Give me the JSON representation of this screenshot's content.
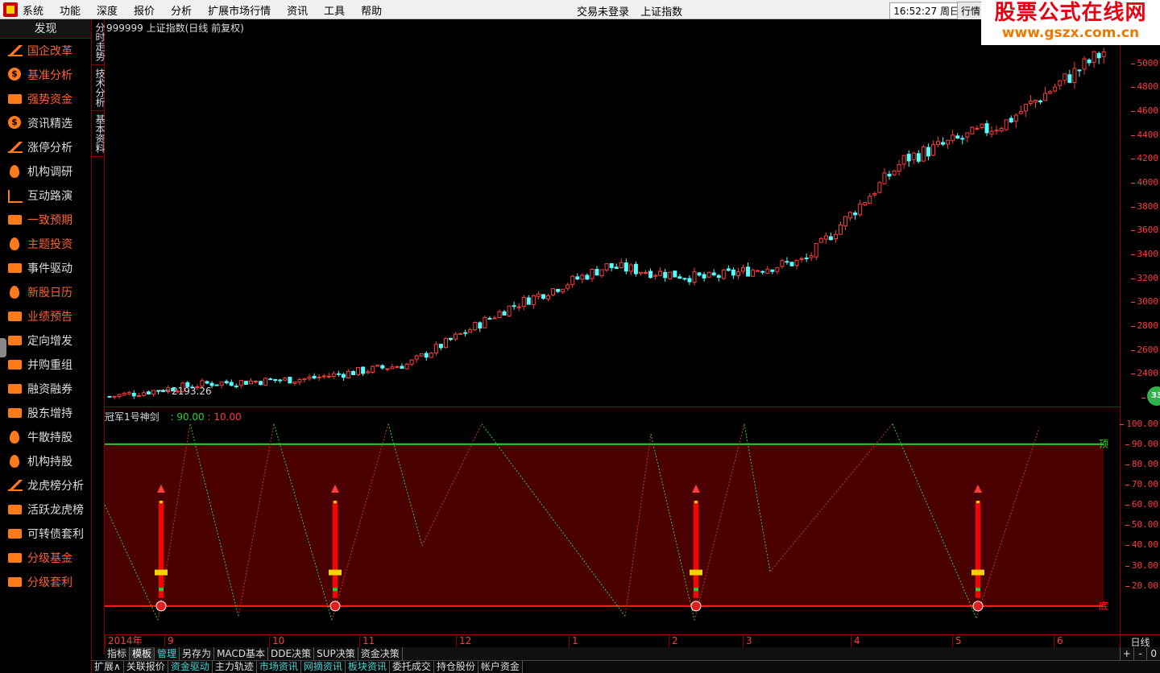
{
  "menu": [
    "系统",
    "功能",
    "深度",
    "报价",
    "分析",
    "扩展市场行情",
    "资讯",
    "工具",
    "帮助"
  ],
  "status": {
    "login": "交易未登录",
    "index_name": "上证指数"
  },
  "clock": "16:52:27 周日",
  "hangqing_button": "行情",
  "brand": {
    "title": "股票公式在线网",
    "url": "www.gszx.com.cn"
  },
  "sidebar": {
    "header": "发现",
    "items": [
      {
        "label": "国企改革",
        "icon": "chart-up-icon",
        "hl": true
      },
      {
        "label": "基准分析",
        "icon": "coins-icon",
        "hl": true
      },
      {
        "label": "强势资金",
        "icon": "briefcase-icon",
        "hl": true
      },
      {
        "label": "资讯精选",
        "icon": "dollar-coin-icon",
        "hl": false
      },
      {
        "label": "涨停分析",
        "icon": "chart-up-icon",
        "hl": false
      },
      {
        "label": "机构调研",
        "icon": "target-icon",
        "hl": false
      },
      {
        "label": "互动路演",
        "icon": "line-chart-icon",
        "hl": false
      },
      {
        "label": "一致预期",
        "icon": "handshake-icon",
        "hl": true
      },
      {
        "label": "主题投资",
        "icon": "umbrella-icon",
        "hl": true
      },
      {
        "label": "事件驱动",
        "icon": "money-bag-icon",
        "hl": false
      },
      {
        "label": "新股日历",
        "icon": "medal-icon",
        "hl": true
      },
      {
        "label": "业绩预告",
        "icon": "wallet-icon",
        "hl": true
      },
      {
        "label": "定向增发",
        "icon": "printer-icon",
        "hl": false
      },
      {
        "label": "并购重组",
        "icon": "piggy-bank-icon",
        "hl": false
      },
      {
        "label": "融资融券",
        "icon": "hand-money-icon",
        "hl": false
      },
      {
        "label": "股东增持",
        "icon": "dollar-doc-icon",
        "hl": false
      },
      {
        "label": "牛散持股",
        "icon": "person-pin-icon",
        "hl": false
      },
      {
        "label": "机构持股",
        "icon": "umbrella-icon",
        "hl": false
      },
      {
        "label": "龙虎榜分析",
        "icon": "bar-chart-icon",
        "hl": false
      },
      {
        "label": "活跃龙虎榜",
        "icon": "user-icon",
        "hl": false
      },
      {
        "label": "可转债套利",
        "icon": "wallet-icon",
        "hl": false
      },
      {
        "label": "分级基金",
        "icon": "piggy-bank-icon",
        "hl": true
      },
      {
        "label": "分级套利",
        "icon": "wallet-icon",
        "hl": true
      }
    ]
  },
  "vtabs": [
    "分时走势",
    "技术分析",
    "基本资料"
  ],
  "main": {
    "title": "999999 上证指数(日线 前复权)",
    "low_label": "2193.26"
  },
  "main_yaxis": [
    "5000",
    "4800",
    "4600",
    "4400",
    "4200",
    "4000",
    "3800",
    "3600",
    "3400",
    "3200",
    "3000",
    "2800",
    "2600",
    "2400",
    "22"
  ],
  "indicator": {
    "name": "冠军1号神剑",
    "top_value": ": 90.00",
    "bottom_value": ": 10.00",
    "top_label": "顶",
    "bottom_label": "底",
    "yaxis": [
      "100.00",
      "90.00",
      "80.00",
      "70.00",
      "60.00",
      "50.00",
      "40.00",
      "30.00",
      "20.00"
    ]
  },
  "xaxis": [
    "2014年",
    "9",
    "10",
    "11",
    "12",
    "1",
    "2",
    "3",
    "4",
    "5",
    "6"
  ],
  "period": "日线",
  "indicator_tabs": [
    {
      "label": "指标",
      "active": false,
      "cyan": false
    },
    {
      "label": "模板",
      "active": true,
      "cyan": false
    },
    {
      "label": "管理",
      "active": false,
      "cyan": true
    },
    {
      "label": "另存为",
      "active": false,
      "cyan": false
    },
    {
      "label": "MACD基本",
      "active": false,
      "cyan": false
    },
    {
      "label": "DDE决策",
      "active": false,
      "cyan": false
    },
    {
      "label": "SUP决策",
      "active": false,
      "cyan": false
    },
    {
      "label": "资金决策",
      "active": false,
      "cyan": false
    }
  ],
  "zoom": [
    "+",
    "-",
    "0"
  ],
  "bottom_tabs": [
    {
      "label": "扩展∧",
      "cyan": false
    },
    {
      "label": "关联报价",
      "cyan": false
    },
    {
      "label": "资金驱动",
      "cyan": true
    },
    {
      "label": "主力轨迹",
      "cyan": false
    },
    {
      "label": "市场资讯",
      "cyan": true
    },
    {
      "label": "网摘资讯",
      "cyan": true
    },
    {
      "label": "板块资讯",
      "cyan": true
    },
    {
      "label": "委托成交",
      "cyan": false
    },
    {
      "label": "持仓股份",
      "cyan": false
    },
    {
      "label": "帐户资金",
      "cyan": false
    }
  ],
  "badge": "33",
  "colors": {
    "up": "#ff3b3b",
    "down": "#54ffff",
    "bg": "#000000",
    "indicator_fill": "#4a0000",
    "top_line": "#2bd22b",
    "bottom_line": "#ff2020"
  },
  "chart_data": [
    {
      "type": "candlestick",
      "title": "999999 上证指数(日线 前复权)",
      "approx_close_path": [
        {
          "x": "2014-08",
          "y": 2210
        },
        {
          "x": "2014-09",
          "y": 2320
        },
        {
          "x": "2014-10",
          "y": 2360
        },
        {
          "x": "2014-11",
          "y": 2480
        },
        {
          "x": "2014-12",
          "y": 2950
        },
        {
          "x": "2015-01",
          "y": 3300
        },
        {
          "x": "2015-02",
          "y": 3200
        },
        {
          "x": "2015-03",
          "y": 3350
        },
        {
          "x": "2015-04",
          "y": 4200
        },
        {
          "x": "2015-05",
          "y": 4500
        },
        {
          "x": "2015-06",
          "y": 5100
        }
      ],
      "annotated_low": 2193.26,
      "ylim": [
        2200,
        5100
      ]
    },
    {
      "type": "line",
      "title": "冠军1号神剑",
      "zigzag": [
        60,
        3,
        100,
        5,
        100,
        3,
        100,
        40,
        100,
        5,
        95,
        3,
        100,
        27,
        100,
        4,
        98
      ],
      "hlines": {
        "top": 90,
        "bottom": 10
      },
      "buy_signals": 4,
      "ylim": [
        0,
        105
      ]
    }
  ]
}
